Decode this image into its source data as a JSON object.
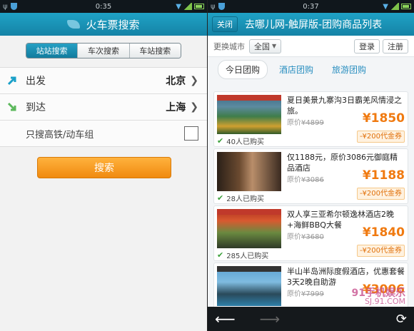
{
  "left": {
    "status": {
      "time": "0:35"
    },
    "title": "火车票搜索",
    "seg_tabs": [
      {
        "label": "站站搜索",
        "active": true
      },
      {
        "label": "车次搜索",
        "active": false
      },
      {
        "label": "车站搜索",
        "active": false
      }
    ],
    "from": {
      "label": "出发",
      "value": "北京"
    },
    "to": {
      "label": "到达",
      "value": "上海"
    },
    "highspeed": {
      "label": "只搜高铁/动车组",
      "checked": false
    },
    "search_button": "搜索"
  },
  "right": {
    "status": {
      "time": "0:37"
    },
    "close_button": "关闭",
    "title": "去哪儿网-触屏版-团购商品列表",
    "city_label": "更换城市",
    "city_value": "全国",
    "login": "登录",
    "register": "注册",
    "tabs": [
      {
        "label": "今日团购",
        "active": true
      },
      {
        "label": "酒店团购",
        "active": false
      },
      {
        "label": "旅游团购",
        "active": false
      }
    ],
    "items": [
      {
        "title": "夏日美景九寨沟3日霸羌风情浸之旅。",
        "orig_label": "原价",
        "orig": "¥4899",
        "price": "¥1850",
        "coupon": "-¥200代金券",
        "sold": "40人已购买"
      },
      {
        "title": "仅1188元，原价3086元御庭精品酒店",
        "orig_label": "原价",
        "orig": "¥3086",
        "price": "¥1188",
        "coupon": "-¥200代金券",
        "sold": "28人已购买"
      },
      {
        "title": "双人享三亚希尔顿逸林酒店2晚+海鲜BBQ大餐",
        "orig_label": "原价",
        "orig": "¥3680",
        "price": "¥1840",
        "coupon": "-¥200代金券",
        "sold": "285人已购买"
      },
      {
        "title": "半山半岛洲际度假酒店，优惠套餐3天2晚自助游",
        "orig_label": "原价",
        "orig": "¥7999",
        "price": "¥3006",
        "coupon": "",
        "sold": ""
      }
    ],
    "watermark_1": "91手机娱乐",
    "watermark_2": "SJ.91.COM"
  }
}
